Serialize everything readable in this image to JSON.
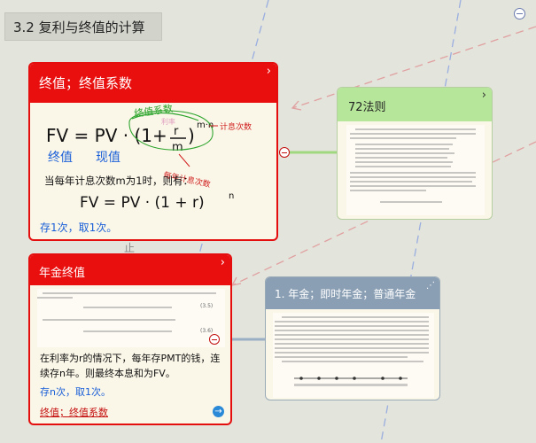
{
  "header": {
    "title": "3.2 复利与终值的计算"
  },
  "fv_card": {
    "title": "终值；终值系数",
    "formula_main": "FV = PV · (1 + r/m)^(m·n)",
    "labels_fv": "终值",
    "labels_pv": "现值",
    "annot_factor": "终值系数",
    "annot_rate": "利率",
    "annot_periods": "计息次数",
    "annot_per_year": "每年计息次数",
    "note_line": "当每年计息次数m为1时，则有：",
    "formula_m1": "FV = PV · (1 + r)^n",
    "footer": "存1次，取1次。"
  },
  "rule72_card": {
    "title": "72法则"
  },
  "annuity_card": {
    "title": "年金终值",
    "eq1_num": "(3.5)",
    "eq2_num": "(3.6)",
    "desc": "在利率为r的情况下，每年存PMT的钱，连续存n年。则最终本息和为FV。",
    "footer": "存n次，取1次。",
    "link": "终值；终值系数"
  },
  "annuity_type_card": {
    "title": "1. 年金；即时年金；普通年金"
  },
  "colors": {
    "accent_red": "#e40e0e",
    "green_head": "#b6e69a",
    "blue_head": "#8a9fb4",
    "link_blue": "#1a5fd8"
  },
  "icons": [
    "collapse-icon",
    "chevron-right-icon",
    "hierarchy-icon",
    "arrow-right-circle-icon"
  ]
}
